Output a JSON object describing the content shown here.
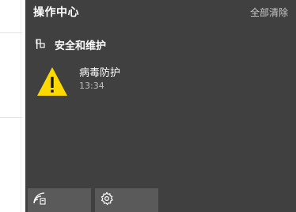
{
  "action_center": {
    "title": "操作中心",
    "clear_all_label": "全部清除",
    "group": {
      "title": "安全和维护",
      "icon": "flag-icon"
    },
    "notification": {
      "title": "病毒防护",
      "time": "13:34",
      "icon": "warning-icon",
      "icon_color": "#ffd800"
    },
    "quick_actions": [
      {
        "icon": "network-icon"
      },
      {
        "icon": "settings-gear-icon"
      }
    ]
  },
  "colors": {
    "panel_background": "#404040",
    "tile_background": "#5a5a5a",
    "text_primary": "#ffffff",
    "text_secondary": "#c0c0c0"
  }
}
